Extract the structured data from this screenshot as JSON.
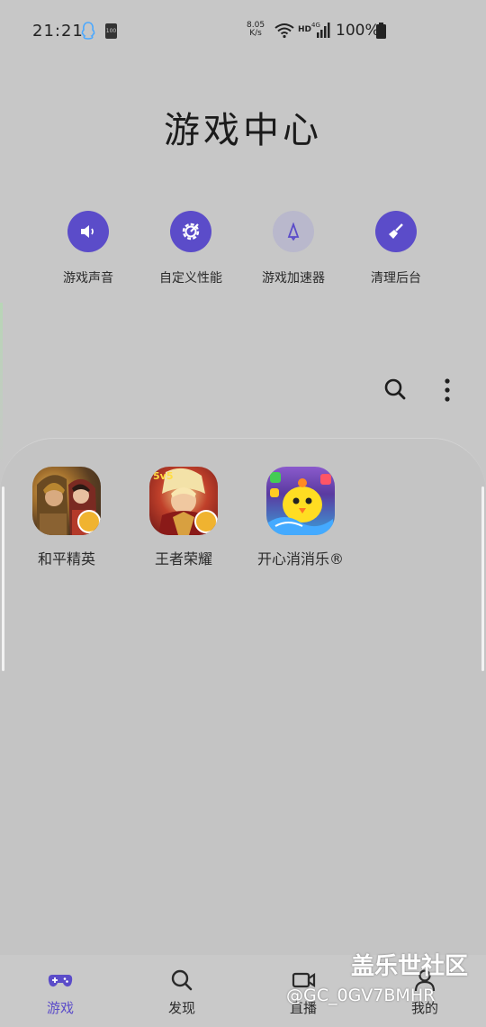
{
  "status_bar": {
    "time": "21:21",
    "network_speed_value": "8.05",
    "network_speed_unit": "K/s",
    "hd_label": "HD",
    "battery_percent": "100%",
    "sd_label": "100",
    "qq_color": "#4aa8ff"
  },
  "page": {
    "title": "游戏中心"
  },
  "quick_actions": [
    {
      "label": "游戏声音",
      "icon": "speaker-icon",
      "active": true
    },
    {
      "label": "自定义性能",
      "icon": "gear-icon",
      "active": true
    },
    {
      "label": "游戏加速器",
      "icon": "rocket-icon",
      "active": false
    },
    {
      "label": "清理后台",
      "icon": "broom-icon",
      "active": true
    }
  ],
  "toolbar": {
    "search_icon": "search-icon",
    "more_icon": "more-vertical-icon"
  },
  "games": [
    {
      "name": "和平精英",
      "icon": "pubg-icon"
    },
    {
      "name": "王者荣耀",
      "icon": "honor-of-kings-icon"
    },
    {
      "name": "开心消消乐®",
      "icon": "happy-elimination-icon"
    }
  ],
  "bottom_nav": [
    {
      "label": "游戏",
      "icon": "gamepad-icon",
      "active": true
    },
    {
      "label": "发现",
      "icon": "search-icon",
      "active": false
    },
    {
      "label": "直播",
      "icon": "video-icon",
      "active": false
    },
    {
      "label": "我的",
      "icon": "person-icon",
      "active": false
    }
  ],
  "watermark": {
    "line1": "盖乐世社区",
    "line2": "@GC_0GV7BMHR"
  },
  "colors": {
    "accent": "#5b4cc9",
    "background": "#c7c7c7",
    "inactive_circle": "#b9b8cc"
  }
}
